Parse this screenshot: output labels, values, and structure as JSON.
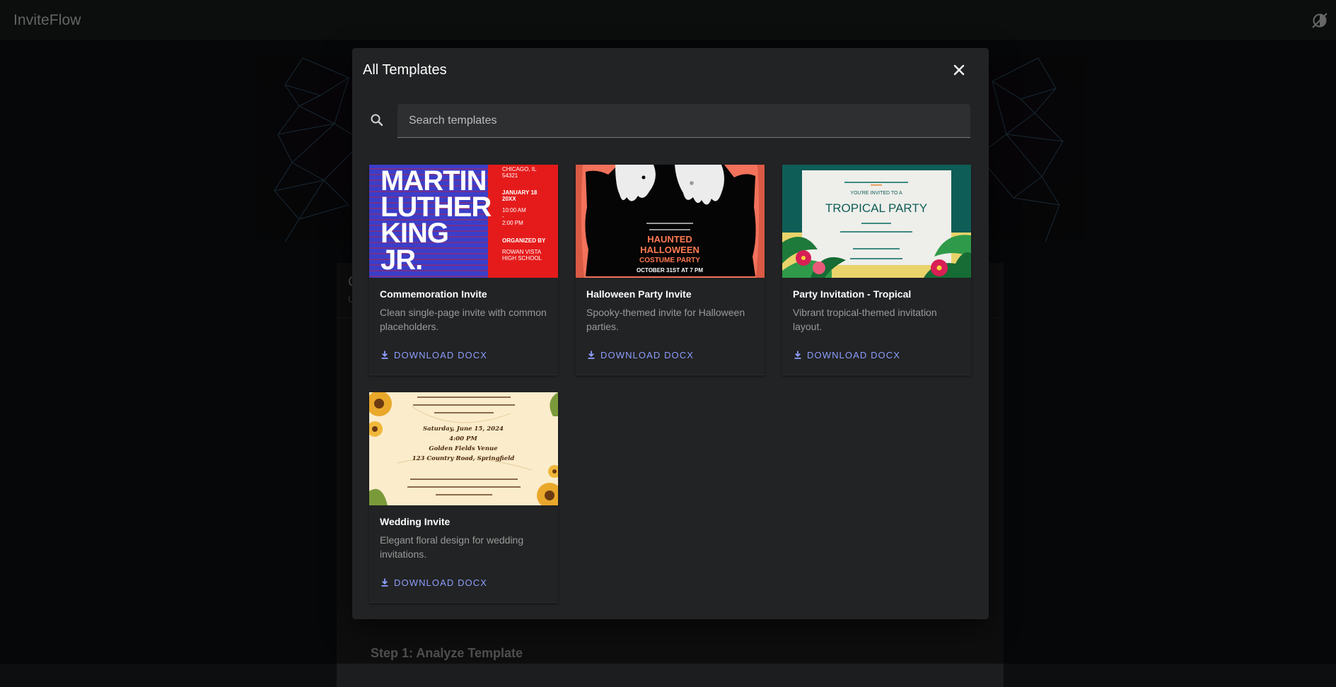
{
  "app": {
    "title": "InviteFlow",
    "theme_toggle_icon": "auto-contrast-icon"
  },
  "background": {
    "card_heading_initial": "C",
    "card_subheading_initial": "U",
    "step_title": "Step 1: Analyze Template"
  },
  "dialog": {
    "title": "All Templates",
    "close_icon": "close-icon",
    "search": {
      "placeholder": "Search templates",
      "value": "",
      "icon": "search-icon"
    },
    "templates": [
      {
        "name": "Commemoration Invite",
        "description": "Clean single-page invite with common placeholders.",
        "download_label": "DOWNLOAD DOCX",
        "download_icon": "download-icon",
        "thumbnail": {
          "headline": [
            "MARTIN",
            "LUTHER",
            "KING",
            "JR."
          ],
          "location": [
            "CHICAGO, IL",
            "54321"
          ],
          "date": [
            "JANUARY 18",
            "20XX"
          ],
          "time": [
            "10:00 AM",
            "-",
            "2:00 PM"
          ],
          "organizer_label": "ORGANIZED BY",
          "organizer": [
            "ROWAN VISTA",
            "HIGH SCHOOL"
          ],
          "colors": {
            "blue": "#3b3ec9",
            "red": "#e51b1b"
          }
        }
      },
      {
        "name": "Halloween Party Invite",
        "description": "Spooky-themed invite for Halloween parties.",
        "download_label": "DOWNLOAD DOCX",
        "download_icon": "download-icon",
        "thumbnail": {
          "headline": [
            "HAUNTED",
            "HALLOWEEN",
            "COSTUME PARTY"
          ],
          "date_line": "OCTOBER 31ST AT 7 PM",
          "colors": {
            "frame": "#f2725b",
            "text": "#ff7a52"
          }
        }
      },
      {
        "name": "Party Invitation - Tropical",
        "description": "Vibrant tropical-themed invitation layout.",
        "download_label": "DOWNLOAD DOCX",
        "download_icon": "download-icon",
        "thumbnail": {
          "intro": "YOU'RE INVITED TO A",
          "headline": "TROPICAL PARTY",
          "colors": {
            "frame": "#0f5d57",
            "accent": "#f6d96b"
          }
        }
      },
      {
        "name": "Wedding Invite",
        "description": "Elegant floral design for wedding invitations.",
        "download_label": "DOWNLOAD DOCX",
        "download_icon": "download-icon",
        "thumbnail": {
          "lines": [
            "Saturday, June 15, 2024",
            "4:00 PM",
            "Golden Fields Venue",
            "123 Country Road, Springfield"
          ],
          "colors": {
            "paper": "#fbeccc",
            "flower": "#e9a82a"
          }
        }
      }
    ]
  }
}
